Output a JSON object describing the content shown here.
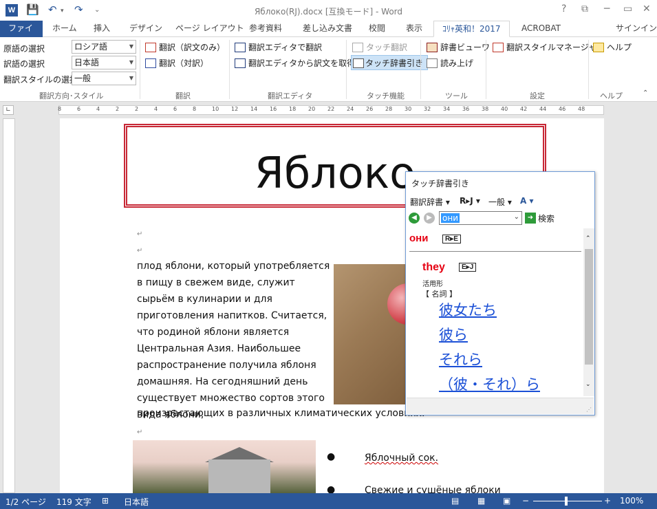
{
  "app": {
    "title": "Яблоко(RJ).docx [互換モード] - Word",
    "window_controls": [
      "?",
      "▢",
      "─",
      "▭",
      "✕"
    ],
    "quick_access": [
      "save-icon",
      "undo-icon",
      "redo-icon"
    ]
  },
  "tabs": [
    {
      "label": "ファイル"
    },
    {
      "label": "ホーム"
    },
    {
      "label": "挿入"
    },
    {
      "label": "デザイン"
    },
    {
      "label": "ページ レイアウト"
    },
    {
      "label": "参考資料"
    },
    {
      "label": "差し込み文書"
    },
    {
      "label": "校閲"
    },
    {
      "label": "表示"
    },
    {
      "label": "ｺﾘｬ英和！2017"
    },
    {
      "label": "ACROBAT"
    }
  ],
  "signin": "サインイン",
  "ribbon": {
    "direction": {
      "source_label": "原語の選択",
      "source_value": "ロシア語",
      "target_label": "訳語の選択",
      "target_value": "日本語",
      "style_label": "翻訳スタイルの選択",
      "style_value": "一般",
      "group_label": "翻訳方向･スタイル"
    },
    "translate": {
      "btn1": "翻訳（訳文のみ）",
      "btn2": "翻訳（対訳）",
      "group_label": "翻訳"
    },
    "editor": {
      "btn1": "翻訳エディタで翻訳",
      "btn2": "翻訳エディタから訳文を取得",
      "group_label": "翻訳エディタ"
    },
    "touch": {
      "btn1": "タッチ翻訳",
      "btn2": "タッチ辞書引き",
      "group_label": "タッチ機能"
    },
    "tools": {
      "btn1": "辞書ビューワ",
      "btn2": "読み上げ",
      "group_label": "ツール"
    },
    "settings": {
      "btn1": "翻訳スタイルマネージャ",
      "group_label": "設定"
    },
    "help": {
      "btn1": "ヘルプ",
      "group_label": "ヘルプ"
    }
  },
  "ruler": [
    "8",
    "6",
    "4",
    "2",
    "2",
    "4",
    "6",
    "8",
    "10",
    "12",
    "14",
    "16",
    "18",
    "20",
    "22",
    "24",
    "26",
    "28",
    "30",
    "32",
    "34",
    "36",
    "38",
    "40",
    "42",
    "44",
    "46",
    "48"
  ],
  "document": {
    "heading": "Яблоко",
    "body": "плод яблони, который употребляется в пищу в свежем виде, служит сырьём в кулинарии и для приготовления напитков. Считается, что родиной яблони является Центральная Азия. Наибольшее распространение получила яблоня домашняя. На сегодняшний день существует множество сортов этого вида яблони,",
    "body_last": "произрастающих в различных климатических условиях.",
    "bullet1": "Яблочный  сок.",
    "bullet2": "Свежие и сушёные яблоки"
  },
  "dict_panel": {
    "title": "タッチ辞書引き",
    "toolbar_dict": "翻訳辞書",
    "toolbar_rj": "R▸J",
    "toolbar_style": "一般",
    "search_value": "они",
    "search_button": "検索",
    "headword": "они",
    "headword_badge": "R▸E",
    "en_word": "they",
    "en_badge": "E▸J",
    "inflection": "活用形",
    "pos": "【 名詞 】",
    "translations": [
      "彼女たち",
      "彼ら",
      "それら",
      "（彼・それ）ら"
    ]
  },
  "status": {
    "page": "1/2 ページ",
    "words": "119 文字",
    "language": "日本語",
    "zoom": "100%"
  }
}
